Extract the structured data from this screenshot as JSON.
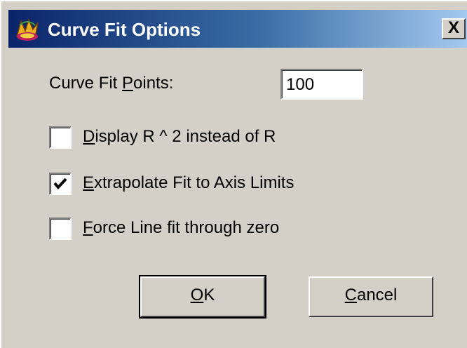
{
  "window": {
    "title": "Curve Fit Options",
    "close_label": "X"
  },
  "curve_fit_points": {
    "label_pre": "Curve Fit ",
    "label_mnemonic": "P",
    "label_post": "oints:",
    "value": "100"
  },
  "options": [
    {
      "mnemonic": "D",
      "rest": "isplay R ^ 2 instead of R",
      "checked": false
    },
    {
      "mnemonic": "E",
      "rest": "xtrapolate Fit to Axis Limits",
      "checked": true
    },
    {
      "mnemonic": "F",
      "rest": "orce Line fit through zero",
      "checked": false
    }
  ],
  "buttons": {
    "ok_mnemonic": "O",
    "ok_rest": "K",
    "cancel_mnemonic": "C",
    "cancel_rest": "ancel"
  }
}
